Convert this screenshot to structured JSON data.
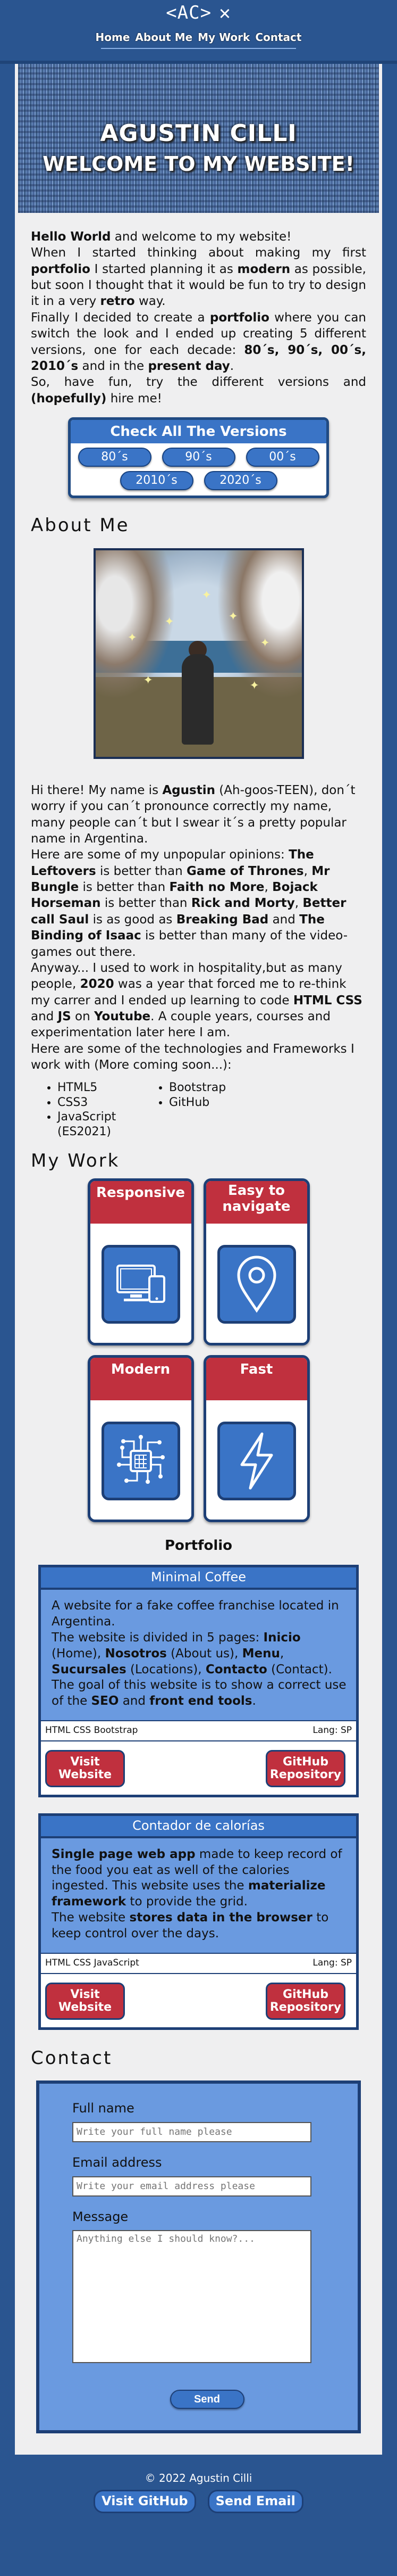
{
  "nav": {
    "logo": "<AC>",
    "close_glyph": "✕",
    "links": [
      "Home",
      "About Me",
      "My Work",
      "Contact"
    ]
  },
  "hero": {
    "name": "AGUSTIN CILLI",
    "welcome": "WELCOME TO MY WEBSITE!"
  },
  "intro": {
    "p1_b1": "Hello World",
    "p1_t1": " and welcome to my website!",
    "p2_t1": "When I started thinking about making my first ",
    "p2_b1": "portfolio",
    "p2_t2": " I started planning it as ",
    "p2_b2": "modern",
    "p2_t3": " as possible, but soon I thought that it would be fun to try to design it in a very ",
    "p2_b3": "retro",
    "p2_t4": " way.",
    "p3_t1": "Finally I decided to create a ",
    "p3_b1": "portfolio",
    "p3_t2": " where you can switch the look and I ended up creating 5 different versions, one for each decade: ",
    "p3_b2": "80´s, 90´s, 00´s, 2010´s",
    "p3_t3": " and in the ",
    "p3_b3": "present day",
    "p3_t4": ".",
    "p4_t1": "So, have fun, try the different versions and ",
    "p4_b1": "(hopefully)",
    "p4_t2": " hire me!"
  },
  "versions": {
    "title": "Check All The Versions",
    "buttons": [
      "80´s",
      "90´s",
      "00´s",
      "2010´s",
      "2020´s"
    ]
  },
  "about": {
    "heading": "About Me",
    "p1_t1": "Hi there! My name is ",
    "p1_b1": "Agustin",
    "p1_t2": " (Ah-goos-TEEN), don´t worry if you can´t pronounce correctly my name, many people can´t but I swear it´s a pretty popular name in Argentina.",
    "p2_t1": "Here are some of my unpopular opinions: ",
    "p2_b1": "The Leftovers",
    "p2_t2": " is better than ",
    "p2_b2": "Game of Thrones",
    "p2_t3": ", ",
    "p2_b3": "Mr Bungle",
    "p2_t4": " is better than ",
    "p2_b4": "Faith no More",
    "p2_t5": ", ",
    "p2_b5": "Bojack Horseman",
    "p2_t6": " is better than ",
    "p2_b6": "Rick and Morty",
    "p2_t7": ", ",
    "p2_b7": "Better call Saul",
    "p2_t8": " is as good as ",
    "p2_b8": "Breaking Bad",
    "p2_t9": " and ",
    "p2_b9": "The Binding of Isaac",
    "p2_t10": " is better than many of the video-games out there.",
    "p3_t1": "Anyway... I used to work in hospitality,but as many people, ",
    "p3_b1": "2020",
    "p3_t2": " was a year that forced me to re-think my carrer and I ended up learning to code ",
    "p3_b2": "HTML CSS",
    "p3_t3": " and ",
    "p3_b3": "JS",
    "p3_t4": " on ",
    "p3_b4": "Youtube",
    "p3_t5": ". A couple years, courses and experimentation later here I am.",
    "p4": "Here are some of the technologies and Frameworks I work with (More coming soon...):",
    "tech_col1": [
      "HTML5",
      "CSS3",
      "JavaScript (ES2021)"
    ],
    "tech_col2": [
      "Bootstrap",
      "GitHub"
    ]
  },
  "work": {
    "heading": "My Work",
    "features": [
      {
        "title": "Responsive",
        "icon": "devices-icon"
      },
      {
        "title": "Easy to navigate",
        "icon": "location-pin-icon"
      },
      {
        "title": "Modern",
        "icon": "chip-icon"
      },
      {
        "title": "Fast",
        "icon": "lightning-icon"
      }
    ],
    "portfolio_title": "Portfolio",
    "projects": [
      {
        "title": "Minimal Coffee",
        "tags": "HTML CSS Bootstrap",
        "lang": "Lang: SP",
        "visit": "Visit Website",
        "github": "GitHub Repository"
      },
      {
        "title": "Contador de calorías",
        "tags": "HTML CSS JavaScript",
        "lang": "Lang: SP",
        "visit": "Visit Website",
        "github": "GitHub Repository"
      }
    ],
    "p1": {
      "d1": "A website for a fake coffee franchise located in Argentina.",
      "d2_t1": "The website is divided in 5 pages: ",
      "d2_b1": "Inicio",
      "d2_t2": " (Home), ",
      "d2_b2": "Nosotros",
      "d2_t3": " (About us), ",
      "d2_b3": "Menu",
      "d2_t4": ", ",
      "d2_b4": "Sucursales",
      "d2_t5": " (Locations), ",
      "d2_b5": "Contacto",
      "d2_t6": " (Contact).",
      "d3_t1": "The goal of this website is to show a correct use of the ",
      "d3_b1": "SEO",
      "d3_t2": " and ",
      "d3_b2": "front end tools",
      "d3_t3": "."
    },
    "p2": {
      "d1_b1": "Single page web app",
      "d1_t1": " made to keep record of the food you eat as well of the calories ingested. This website uses the ",
      "d1_b2": "materialize framework",
      "d1_t2": " to provide the grid.",
      "d2_t1": "The website ",
      "d2_b1": "stores data in the browser",
      "d2_t2": " to keep control over the days."
    }
  },
  "contact": {
    "heading": "Contact",
    "name_label": "Full name",
    "name_placeholder": "Write your full name please",
    "email_label": "Email address",
    "email_placeholder": "Write your email address please",
    "message_label": "Message",
    "message_placeholder": "Anything else I should know?...",
    "send": "Send"
  },
  "footer": {
    "copyright": "© 2022 Agustin Cilli",
    "github": "Visit GitHub",
    "email": "Send Email"
  },
  "colors": {
    "accent_blue": "#3a74c6",
    "dark_blue": "#1d3f76",
    "red": "#c0303e",
    "panel_blue": "#6a9ae0"
  }
}
